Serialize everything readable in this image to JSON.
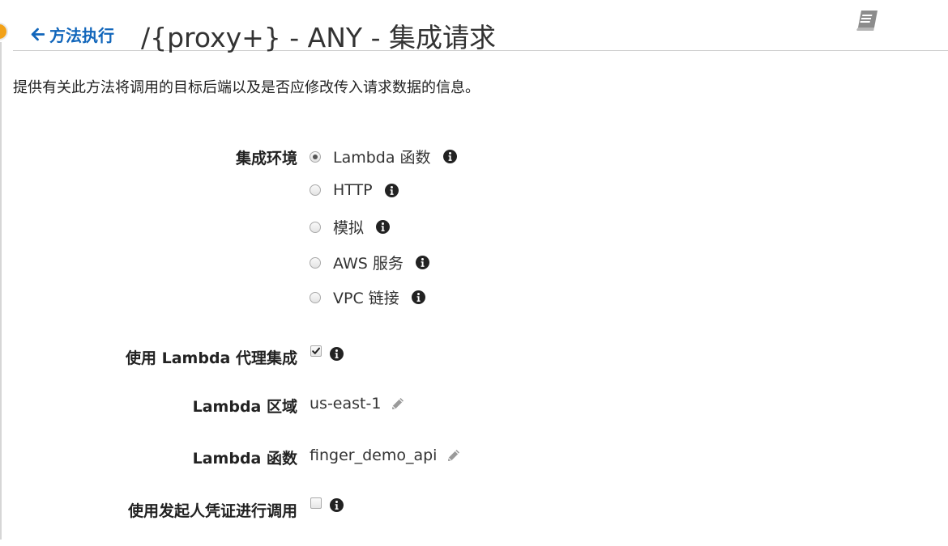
{
  "header": {
    "back_label": "方法执行",
    "title": "/{proxy+} - ANY - 集成请求"
  },
  "description": "提供有关此方法将调用的目标后端以及是否应修改传入请求数据的信息。",
  "integration_type": {
    "label": "集成环境",
    "options": [
      {
        "label": "Lambda 函数",
        "selected": true
      },
      {
        "label": "HTTP",
        "selected": false
      },
      {
        "label": "模拟",
        "selected": false
      },
      {
        "label": "AWS 服务",
        "selected": false
      },
      {
        "label": "VPC 链接",
        "selected": false
      }
    ]
  },
  "lambda_proxy": {
    "label": "使用 Lambda 代理集成",
    "checked": true
  },
  "lambda_region": {
    "label": "Lambda 区域",
    "value": "us-east-1"
  },
  "lambda_function": {
    "label": "Lambda 函数",
    "value": "finger_demo_api"
  },
  "caller_credentials": {
    "label": "使用发起人凭证进行调用",
    "checked": false
  },
  "colors": {
    "link": "#1166bb",
    "accent_dot": "#f2a118"
  },
  "icons": {
    "back": "arrow-left-icon",
    "docs": "book-icon",
    "info": "info-icon",
    "edit": "pencil-icon"
  }
}
